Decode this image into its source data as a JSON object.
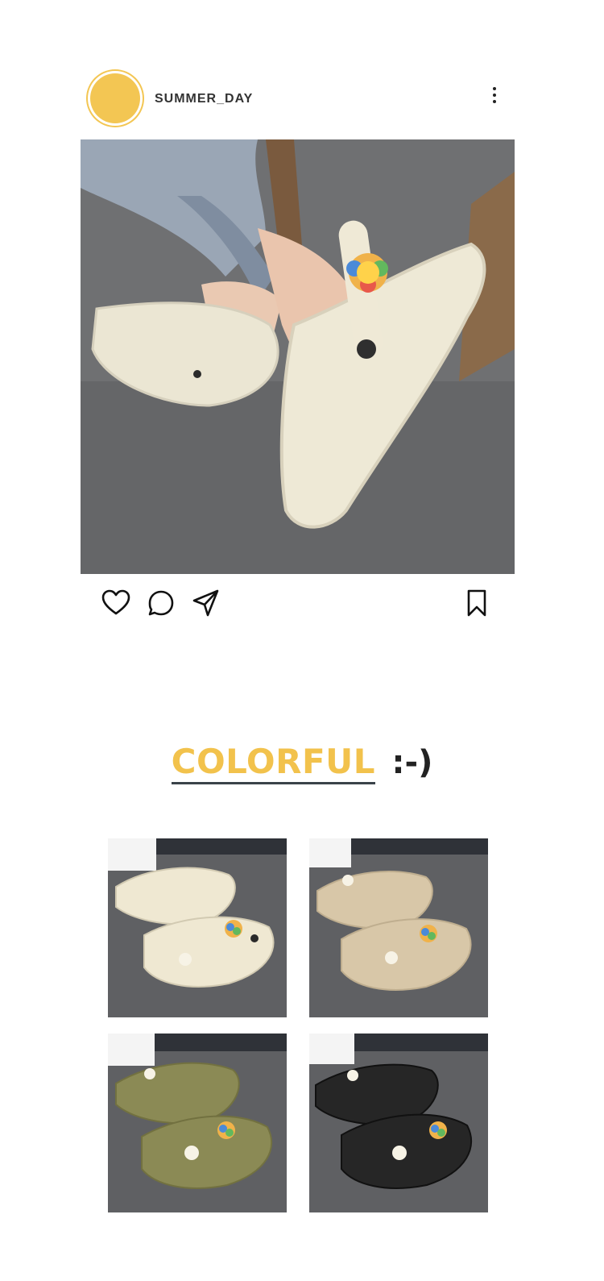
{
  "post": {
    "username": "SUMMER_DAY",
    "avatar_color": "#f3c653",
    "icons": [
      "more-vertical-icon",
      "heart-icon",
      "comment-icon",
      "share-icon",
      "bookmark-icon"
    ]
  },
  "section": {
    "title": "COLORFUL",
    "emoticon": ":-)",
    "title_color": "#f2c24c"
  },
  "variants": [
    {
      "color_name": "cream",
      "hex": "#efe8d2"
    },
    {
      "color_name": "khaki",
      "hex": "#d8c7a8"
    },
    {
      "color_name": "olive",
      "hex": "#8b8a55"
    },
    {
      "color_name": "black",
      "hex": "#262626"
    }
  ]
}
